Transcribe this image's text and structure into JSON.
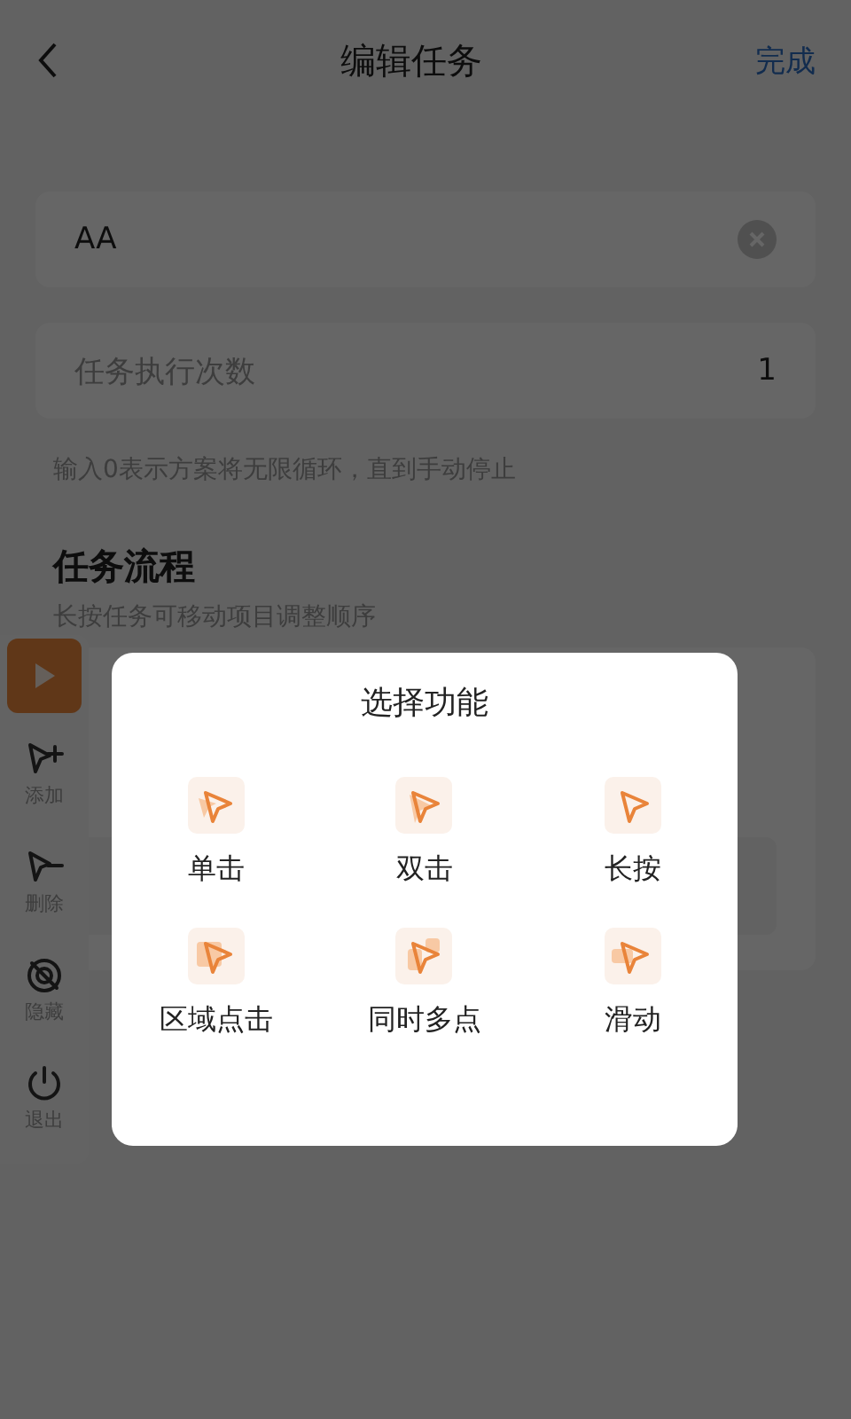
{
  "header": {
    "title": "编辑任务",
    "action": "完成"
  },
  "name_field": {
    "value": "AA"
  },
  "count_field": {
    "label": "任务执行次数",
    "value": "1"
  },
  "hint": "输入0表示方案将无限循环，直到手动停止",
  "flow": {
    "title": "任务流程",
    "subtitle": "长按任务可移动项目调整顺序"
  },
  "toolbar": {
    "items": [
      {
        "kind": "play"
      },
      {
        "kind": "add",
        "label": "添加"
      },
      {
        "kind": "remove",
        "label": "删除"
      },
      {
        "kind": "hide",
        "label": "隐藏"
      },
      {
        "kind": "exit",
        "label": "退出"
      }
    ]
  },
  "dialog": {
    "title": "选择功能",
    "options": [
      {
        "kind": "single",
        "label": "单击"
      },
      {
        "kind": "double",
        "label": "双击"
      },
      {
        "kind": "long",
        "label": "长按"
      },
      {
        "kind": "area",
        "label": "区域点击"
      },
      {
        "kind": "multi",
        "label": "同时多点"
      },
      {
        "kind": "swipe",
        "label": "滑动"
      }
    ]
  }
}
